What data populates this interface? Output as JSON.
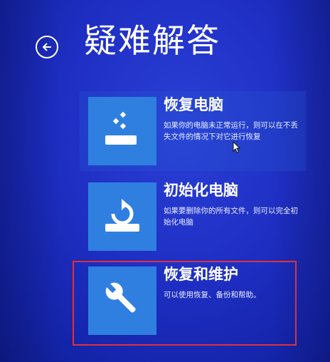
{
  "header": {
    "title": "疑难解答",
    "back_icon": "back-arrow-icon"
  },
  "options": [
    {
      "id": "refresh-pc",
      "title": "恢复电脑",
      "description": "如果你的电脑未正常运行，则可以在不丢失文件的情况下对它进行恢复",
      "icon": "refresh-pc-icon",
      "hovered": true
    },
    {
      "id": "reset-pc",
      "title": "初始化电脑",
      "description": "如果要删除你的所有文件，则可以完全初始化电脑",
      "icon": "reset-pc-icon",
      "hovered": false
    },
    {
      "id": "repair",
      "title": "恢复和维护",
      "description": "可以使用恢复、备份和帮助。",
      "icon": "wrench-icon",
      "highlighted": true
    }
  ],
  "colors": {
    "background": "#1f2fc4",
    "tile_icon_background": "#2f7fe0",
    "highlight_frame": "#e0303a",
    "text": "#ffffff"
  }
}
